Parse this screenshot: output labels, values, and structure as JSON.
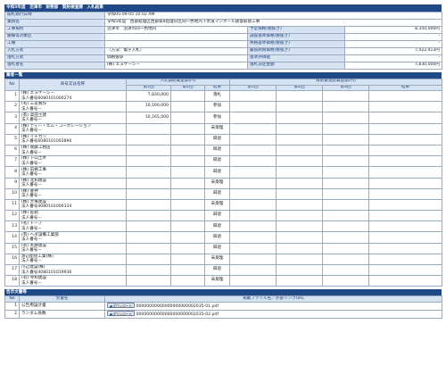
{
  "header": {
    "title": "令和5年度　沼津市　財務部　契約検査課　入札結果"
  },
  "info": {
    "rows": [
      {
        "l1": "開札執行日時",
        "v1": "令和05-09-05 10:02 AM"
      },
      {
        "l1": "業務名",
        "v1": "令和5年度　西部処理区西部第8処理分区同一色地内下水道マンホール鉄蓋取替工事"
      },
      {
        "l1": "工事場所",
        "v1": "沼津市　沼津市同一色地内",
        "l2": "予定価格(税抜き)",
        "v2": "8,350,000円"
      },
      {
        "l1": "路線等対象区",
        "v1": "",
        "l2": "調査基準価格(税抜き)",
        "v2": "-"
      },
      {
        "l1": "工種",
        "v1": "",
        "l2": "失格基準価格(税抜き)",
        "v2": "-"
      },
      {
        "l1": "入札方式",
        "v1": "（方法：電子入札）",
        "l2": "最低制限価格(税抜き)",
        "v2": "7,422,413円"
      },
      {
        "l1": "落札方式",
        "v1": "価格競争",
        "l2": "基準評価値",
        "v2": "-"
      },
      {
        "l1": "落札者名",
        "v1": "(株) エヌケーシー",
        "l2": "落札決定金額",
        "v2": "7,830,000円"
      }
    ]
  },
  "bid_section": {
    "title": "業者一覧",
    "col_no": "No",
    "col_name": "商号又は名称",
    "group_amount": "入札額記載金額(円)",
    "group_score": "技術審査記載金額(円)",
    "sub_round1": "第1回",
    "sub_round2": "第2回",
    "sub_round3": "第3回",
    "sub_result": "結果"
  },
  "bidders": [
    {
      "no": "1",
      "name": "(株) エヌケーシー",
      "sub": "法人番号6080101000274",
      "amount1": "7,830,000",
      "result": "落札"
    },
    {
      "no": "2",
      "name": "(有) 三友製作",
      "sub": "法人番号－",
      "amount1": "10,100,000",
      "result": "参加"
    },
    {
      "no": "3",
      "name": "(有) 高田土建",
      "sub": "法人番号－",
      "amount1": "10,165,000",
      "result": "参加"
    },
    {
      "no": "4",
      "name": "(株) ティー・エム・コーポレーション",
      "sub": "法人番号－",
      "amount1": "",
      "result": "未受理"
    },
    {
      "no": "5",
      "name": "(株) イチカワ",
      "sub": "法人番号6080101003896",
      "amount1": "",
      "result": "辞退"
    },
    {
      "no": "6",
      "name": "(株) 後藤工務店",
      "sub": "法人番号－",
      "amount1": "",
      "result": "辞退"
    },
    {
      "no": "7",
      "name": "(株) 下山土木",
      "sub": "法人番号－",
      "amount1": "",
      "result": "辞退"
    },
    {
      "no": "8",
      "name": "(株) 前嶋工事",
      "sub": "法人番号－",
      "amount1": "",
      "result": "辞退"
    },
    {
      "no": "9",
      "name": "(株) 北和建設",
      "sub": "法人番号－",
      "amount1": "",
      "result": "未受理"
    },
    {
      "no": "10",
      "name": "(株) 豊神",
      "sub": "法人番号－",
      "amount1": "",
      "result": "辞退"
    },
    {
      "no": "11",
      "name": "(株) 大塚建設",
      "sub": "法人番号4080101000334",
      "amount1": "",
      "result": "未受理"
    },
    {
      "no": "12",
      "name": "(株) 匠組",
      "sub": "法人番号－",
      "amount1": "",
      "result": "辞退"
    },
    {
      "no": "13",
      "name": "(有) トーブ",
      "sub": "法人番号－",
      "amount1": "",
      "result": "辞退"
    },
    {
      "no": "14",
      "name": "(有) ヘダ設備工業部",
      "sub": "法人番号－",
      "amount1": "",
      "result": "辞退"
    },
    {
      "no": "15",
      "name": "(有) 丸勝建設",
      "sub": "法人番号－",
      "amount1": "",
      "result": "辞退"
    },
    {
      "no": "16",
      "name": "渡辺配管工業(株)",
      "sub": "法人番号－",
      "amount1": "",
      "result": "未受理"
    },
    {
      "no": "17",
      "name": "川辺建設(株)",
      "sub": "法人番号4080101019936",
      "amount1": "",
      "result": "辞退"
    },
    {
      "no": "18",
      "name": "(有) 寺和建設",
      "sub": "法人番号－",
      "amount1": "",
      "result": "未受理"
    }
  ],
  "docs_section": {
    "title": "告示文書等",
    "col_no": "No",
    "col_name": "文書名",
    "col_file": "掲載ファイル名／外部リンクURL",
    "download_label": "ダウンロード",
    "items": [
      {
        "no": "1",
        "name": "公告用設計書",
        "file": "00000000000000000000002035-01.pdf"
      },
      {
        "no": "2",
        "name": "ランダム係数",
        "file": "00000000000000000000002035-02.pdf"
      }
    ]
  }
}
